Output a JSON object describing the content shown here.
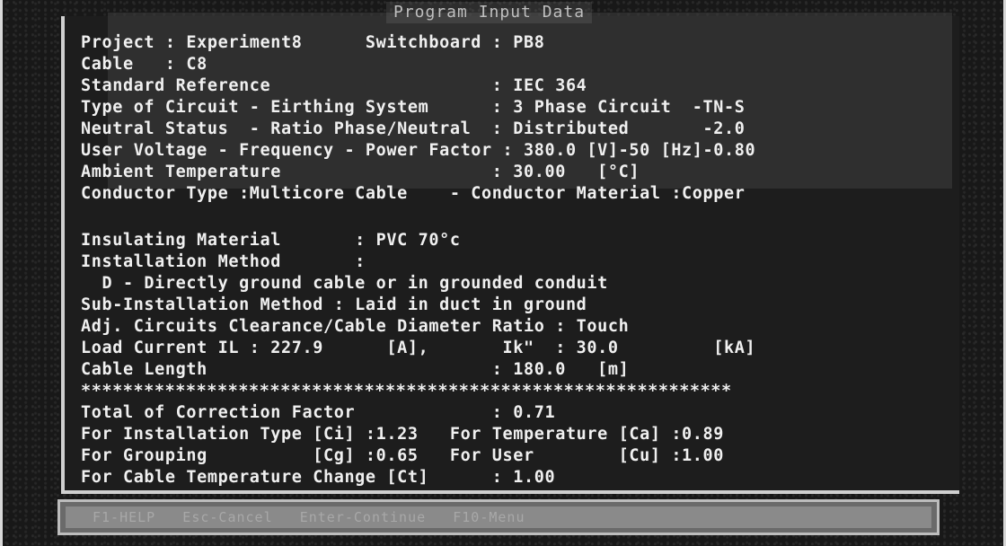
{
  "window": {
    "title": "Program Input Data"
  },
  "lines": [
    "Project : Experiment8      Switchboard : PB8",
    "Cable   : C8",
    "Standard Reference                     : IEC 364",
    "Type of Circuit - Eirthing System      : 3 Phase Circuit  -TN-S",
    "Neutral Status  - Ratio Phase/Neutral  : Distributed       -2.0",
    "User Voltage - Frequency - Power Factor : 380.0 [V]-50 [Hz]-0.80",
    "Ambient Temperature                    : 30.00   [°C]",
    "Conductor Type :Multicore Cable    - Conductor Material :Copper",
    "",
    "Insulating Material       : PVC 70°c",
    "Installation Method       :",
    "  D - Directly ground cable or in grounded conduit",
    "Sub-Installation Method : Laid in duct in ground",
    "Adj. Circuits Clearance/Cable Diameter Ratio : Touch",
    "Load Current IL : 227.9      [A],       Ik\"  : 30.0         [kA]",
    "Cable Length                           : 180.0   [m]",
    "**************************************************************",
    "Total of Correction Factor             : 0.71",
    "For Installation Type [Ci] :1.23   For Temperature [Ca] :0.89",
    "For Grouping          [Cg] :0.65   For User        [Cu] :1.00",
    "For Cable Temperature Change [Ct]      : 1.00"
  ],
  "statusbar": {
    "text": "F1-HELP   Esc-Cancel   Enter-Continue   F10-Menu"
  }
}
